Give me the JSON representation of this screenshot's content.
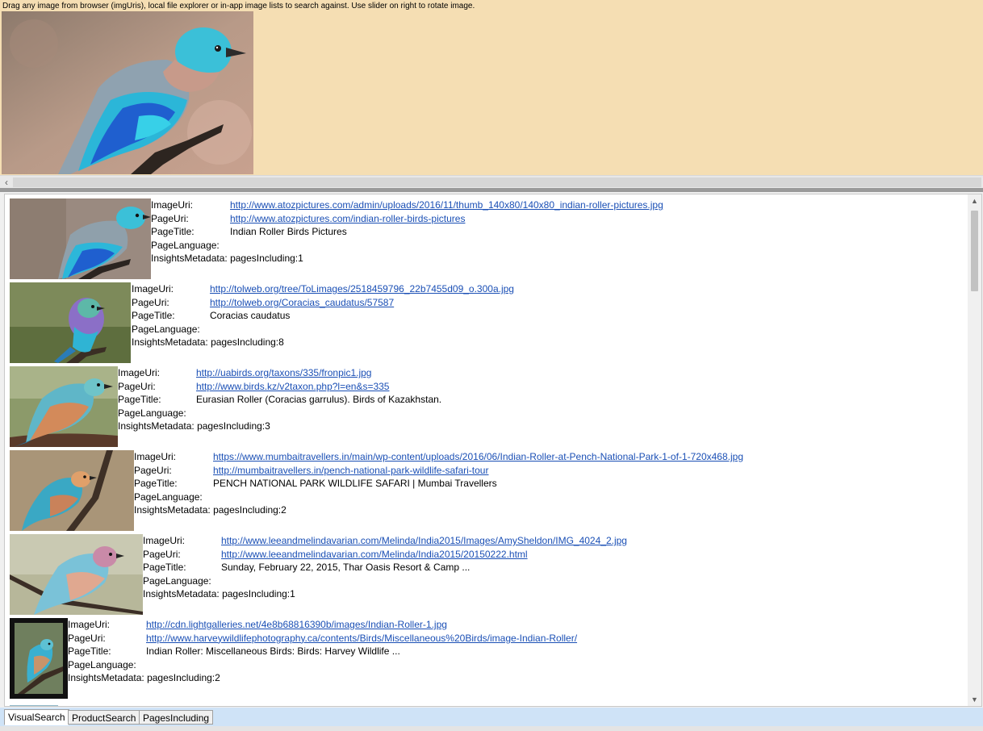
{
  "window": {
    "instructions": "Drag any image from browser (imgUris), local file explorer or in-app image lists to search against. Use slider on right to rotate image."
  },
  "scroll_icons": {
    "left": "chevron-left-icon",
    "up": "chevron-up-icon",
    "down": "chevron-down-icon"
  },
  "labels": {
    "image_uri": "ImageUri:",
    "page_uri": "PageUri:",
    "page_title": "PageTitle:",
    "page_language": "PageLanguage:",
    "insights": "InsightsMetadata:"
  },
  "results": [
    {
      "image_uri": "http://www.atozpictures.com/admin/uploads/2016/11/thumb_140x80/140x80_indian-roller-pictures.jpg",
      "page_uri": "http://www.atozpictures.com/indian-roller-birds-pictures",
      "page_title": "Indian Roller Birds Pictures",
      "page_language": "",
      "insights": "pagesIncluding:1"
    },
    {
      "image_uri": "http://tolweb.org/tree/ToLimages/2518459796_22b7455d09_o.300a.jpg",
      "page_uri": "http://tolweb.org/Coracias_caudatus/57587",
      "page_title": "Coracias caudatus",
      "page_language": "",
      "insights": "pagesIncluding:8"
    },
    {
      "image_uri": "http://uabirds.org/taxons/335/fronpic1.jpg",
      "page_uri": "http://www.birds.kz/v2taxon.php?l=en&s=335",
      "page_title": "Eurasian Roller (Coracias garrulus). Birds of Kazakhstan.",
      "page_language": "",
      "insights": "pagesIncluding:3"
    },
    {
      "image_uri": "https://www.mumbaitravellers.in/main/wp-content/uploads/2016/06/Indian-Roller-at-Pench-National-Park-1-of-1-720x468.jpg",
      "page_uri": "http://mumbaitravellers.in/pench-national-park-wildlife-safari-tour",
      "page_title": "PENCH NATIONAL PARK WILDLIFE SAFARI | Mumbai Travellers",
      "page_language": "",
      "insights": "pagesIncluding:2"
    },
    {
      "image_uri": "http://www.leeandmelindavarian.com/Melinda/India2015/Images/AmySheldon/IMG_4024_2.jpg",
      "page_uri": "http://www.leeandmelindavarian.com/Melinda/India2015/20150222.html",
      "page_title": "Sunday, February 22, 2015, Thar Oasis Resort & Camp ...",
      "page_language": "",
      "insights": "pagesIncluding:1"
    },
    {
      "image_uri": "http://cdn.lightgalleries.net/4e8b68816390b/images/Indian-Roller-1.jpg",
      "page_uri": "http://www.harveywildlifephotography.ca/contents/Birds/Miscellaneous%20Birds/image-Indian-Roller/",
      "page_title": "Indian Roller: Miscellaneous Birds: Birds: Harvey Wildlife ...",
      "page_language": "",
      "insights": "pagesIncluding:2"
    }
  ],
  "tabs": [
    {
      "label": "VisualSearch",
      "active": true
    },
    {
      "label": "ProductSearch",
      "active": false
    },
    {
      "label": "PagesIncluding",
      "active": false
    }
  ]
}
